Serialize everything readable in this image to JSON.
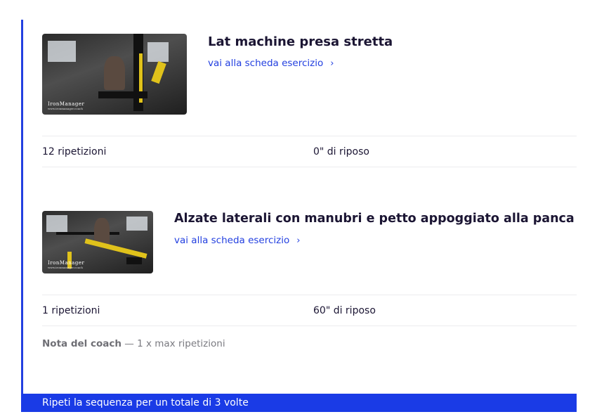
{
  "exercises": [
    {
      "title": "Lat machine presa stretta",
      "link_label": "vai alla scheda esercizio",
      "reps": "12 ripetizioni",
      "rest": "0\" di riposo",
      "thumbnail": {
        "watermark": "IronManager",
        "watermark_url": "www.ironmanager.coach"
      }
    },
    {
      "title": "Alzate laterali con manubri e petto appoggiato alla panca",
      "link_label": "vai alla scheda esercizio",
      "reps": "1 ripetizioni",
      "rest": "60\" di riposo",
      "thumbnail": {
        "watermark": "IronManager",
        "watermark_url": "www.ironmanager.coach"
      },
      "coach_note": {
        "label": "Nota del coach",
        "separator": " — ",
        "text": "1 x max ripetizioni"
      }
    }
  ],
  "footer": {
    "repeat_text": "Ripeti la sequenza per un totale di 3 volte"
  },
  "icons": {
    "link_chevron": "chevron-right-icon"
  },
  "colors": {
    "accent": "#1a3be6",
    "title": "#1b1533",
    "muted": "#7a7a80",
    "divider": "#ececef"
  }
}
